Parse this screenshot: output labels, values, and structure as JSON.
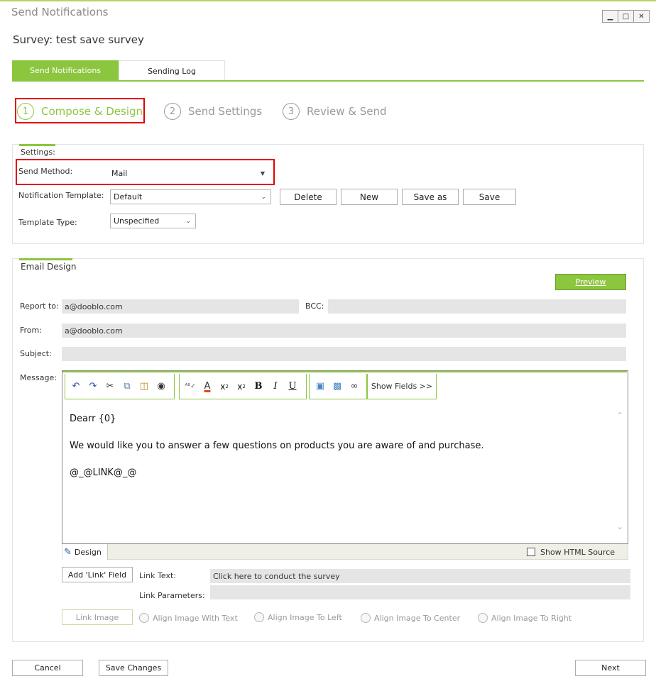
{
  "window": {
    "title": "Send Notifications",
    "controls": {
      "minimize": "▁",
      "maximize": "□",
      "close": "✕"
    }
  },
  "survey_title": "Survey: test save survey",
  "tabs": [
    {
      "label": "Send Notifications",
      "active": true
    },
    {
      "label": "Sending Log",
      "active": false
    }
  ],
  "steps": [
    {
      "num": "1",
      "label": "Compose & Design",
      "active": true
    },
    {
      "num": "2",
      "label": "Send Settings",
      "active": false
    },
    {
      "num": "3",
      "label": "Review & Send",
      "active": false
    }
  ],
  "settings": {
    "heading": "Settings:",
    "send_method_label": "Send Method:",
    "send_method_value": "Mail",
    "notification_template_label": "Notification Template:",
    "notification_template_value": "Default",
    "template_type_label": "Template Type:",
    "template_type_value": "Unspecified",
    "buttons": {
      "delete": "Delete",
      "new": "New",
      "save_as": "Save as",
      "save": "Save"
    }
  },
  "email_design": {
    "heading": "Email Design",
    "preview_button": "Preview",
    "report_to_label": "Report to:",
    "report_to_value": "a@dooblo.com",
    "bcc_label": "BCC:",
    "bcc_value": "",
    "from_label": "From:",
    "from_value": "a@dooblo.com",
    "subject_label": "Subject:",
    "subject_value": "",
    "message_label": "Message:",
    "show_fields_button": "Show Fields >>",
    "message_lines": [
      "Dearr {0}",
      "We would like you to answer a few questions on products you are aware of and purchase.",
      "@_@LINK@_@"
    ],
    "design_tab_label": "Design",
    "show_html_source_label": "Show HTML Source",
    "add_link_field_button": "Add 'Link' Field",
    "link_text_label": "Link Text:",
    "link_text_value": "Click here to conduct the survey",
    "link_parameters_label": "Link Parameters:",
    "link_parameters_value": "",
    "link_image_button": "Link Image",
    "align_options": [
      "Align Image With Text",
      "Align Image To Left",
      "Align Image To Center",
      "Align Image To Right"
    ]
  },
  "footer": {
    "cancel": "Cancel",
    "save_changes": "Save Changes",
    "next": "Next"
  },
  "colors": {
    "accent": "#8cc63f",
    "highlight_box": "#e30000"
  },
  "toolbar_icons": {
    "group1": [
      "undo-icon",
      "redo-icon",
      "cut-icon",
      "copy-icon",
      "paste-icon",
      "find-icon"
    ],
    "group2": [
      "spellcheck-icon",
      "font-color-icon",
      "subscript-icon",
      "superscript-icon",
      "bold-icon",
      "italic-icon",
      "underline-icon"
    ],
    "group3": [
      "insert-image-icon",
      "insert-object-icon",
      "insert-link-icon"
    ]
  }
}
